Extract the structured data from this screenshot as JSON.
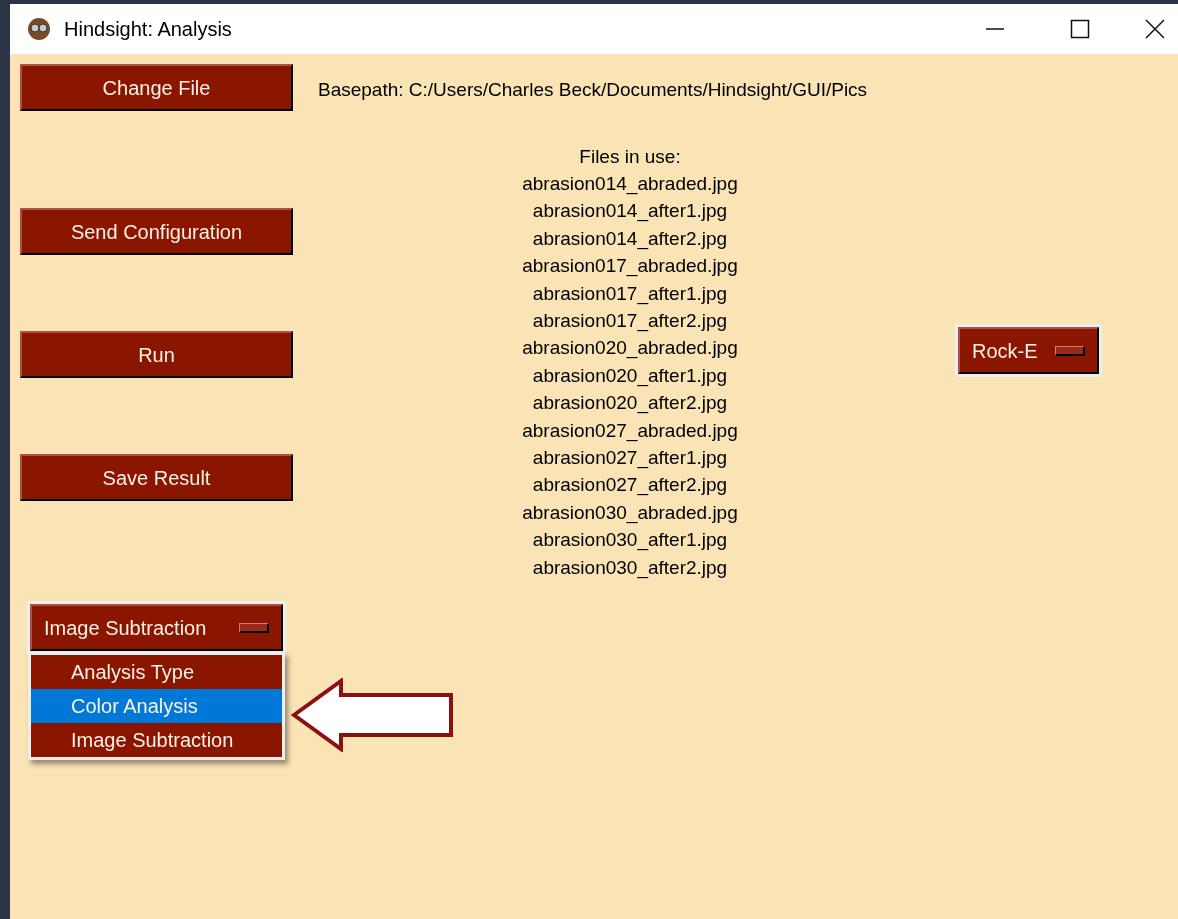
{
  "window": {
    "title": "Hindsight: Analysis"
  },
  "buttons": [
    "Change File",
    "Send Configuration",
    "Run",
    "Save Result"
  ],
  "basepath": "Basepath: C:/Users/Charles Beck/Documents/Hindsight/GUI/Pics",
  "files": {
    "heading": "Files in use:",
    "items": [
      "abrasion014_abraded.jpg",
      "abrasion014_after1.jpg",
      "abrasion014_after2.jpg",
      "abrasion017_abraded.jpg",
      "abrasion017_after1.jpg",
      "abrasion017_after2.jpg",
      "abrasion020_abraded.jpg",
      "abrasion020_after1.jpg",
      "abrasion020_after2.jpg",
      "abrasion027_abraded.jpg",
      "abrasion027_after1.jpg",
      "abrasion027_after2.jpg",
      "abrasion030_abraded.jpg",
      "abrasion030_after1.jpg",
      "abrasion030_after2.jpg"
    ]
  },
  "analysis_menu": {
    "value": "Image Subtraction",
    "expanded": true,
    "options": [
      {
        "label": "Analysis Type",
        "highlighted": false
      },
      {
        "label": "Color Analysis",
        "highlighted": true
      },
      {
        "label": "Image Subtraction",
        "highlighted": false
      }
    ]
  },
  "rock_menu": {
    "value": "Rock-E"
  }
}
